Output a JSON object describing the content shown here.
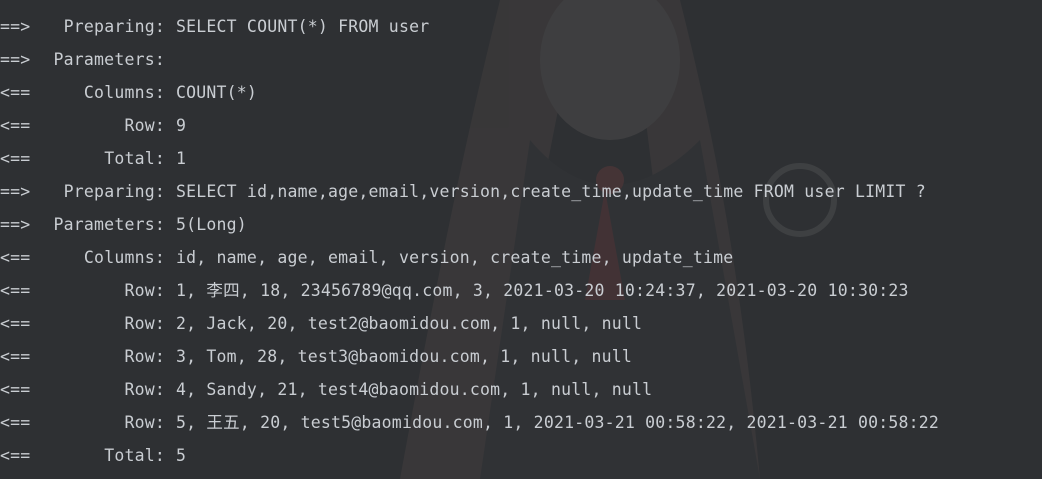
{
  "console": {
    "lines": [
      {
        "arrow": "==>",
        "label": "Preparing:",
        "text": "SELECT COUNT(*) FROM user"
      },
      {
        "arrow": "==>",
        "label": "Parameters:",
        "text": ""
      },
      {
        "arrow": "<==",
        "label": "Columns:",
        "text": "COUNT(*)"
      },
      {
        "arrow": "<==",
        "label": "Row:",
        "text": "9"
      },
      {
        "arrow": "<==",
        "label": "Total:",
        "text": "1"
      },
      {
        "arrow": "==>",
        "label": "Preparing:",
        "text": "SELECT id,name,age,email,version,create_time,update_time FROM user LIMIT ?"
      },
      {
        "arrow": "==>",
        "label": "Parameters:",
        "text": "5(Long)"
      },
      {
        "arrow": "<==",
        "label": "Columns:",
        "text": "id, name, age, email, version, create_time, update_time"
      },
      {
        "arrow": "<==",
        "label": "Row:",
        "text": "1, 李四, 18, 23456789@qq.com, 3, 2021-03-20 10:24:37, 2021-03-20 10:30:23"
      },
      {
        "arrow": "<==",
        "label": "Row:",
        "text": "2, Jack, 20, test2@baomidou.com, 1, null, null"
      },
      {
        "arrow": "<==",
        "label": "Row:",
        "text": "3, Tom, 28, test3@baomidou.com, 1, null, null"
      },
      {
        "arrow": "<==",
        "label": "Row:",
        "text": "4, Sandy, 21, test4@baomidou.com, 1, null, null"
      },
      {
        "arrow": "<==",
        "label": "Row:",
        "text": "5, 王五, 20, test5@baomidou.com, 1, 2021-03-21 00:58:22, 2021-03-21 00:58:22"
      },
      {
        "arrow": "<==",
        "label": "Total:",
        "text": "5"
      }
    ]
  },
  "colors": {
    "background": "#2e3033",
    "text": "#c9cdd2"
  }
}
